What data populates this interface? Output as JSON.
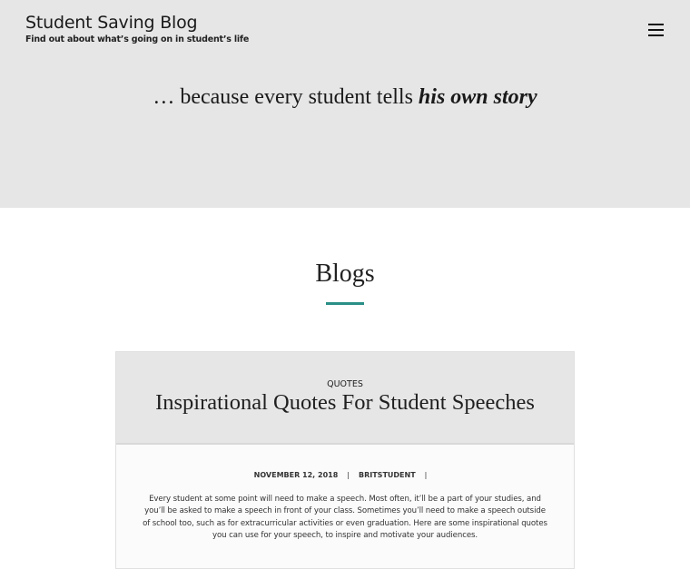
{
  "site": {
    "title": "Student Saving Blog",
    "tagline": "Find out about what’s going on in student’s life"
  },
  "hero": {
    "quote_prefix": "… because every student tells ",
    "quote_emphasis": "his own story"
  },
  "section": {
    "title": "Blogs"
  },
  "post": {
    "category": "QUOTES",
    "title": "Inspirational Quotes For Student Speeches",
    "date": "NOVEMBER 12, 2018",
    "separator": "|",
    "author": "BRITSTUDENT",
    "excerpt": "Every student at some point will need to make a speech. Most often, it’ll be a part of your studies, and you’ll be asked to make a speech in front of your class. Sometimes you’ll need to make a speech outside of school too, such as for extracurricular activities or even graduation. Here are some inspirational quotes you can use for your speech, to inspire and motivate your audiences."
  },
  "colors": {
    "hero_background": "#e6e6e6",
    "accent": "#2a8f86"
  },
  "icons": {
    "menu": "hamburger-menu-icon"
  }
}
